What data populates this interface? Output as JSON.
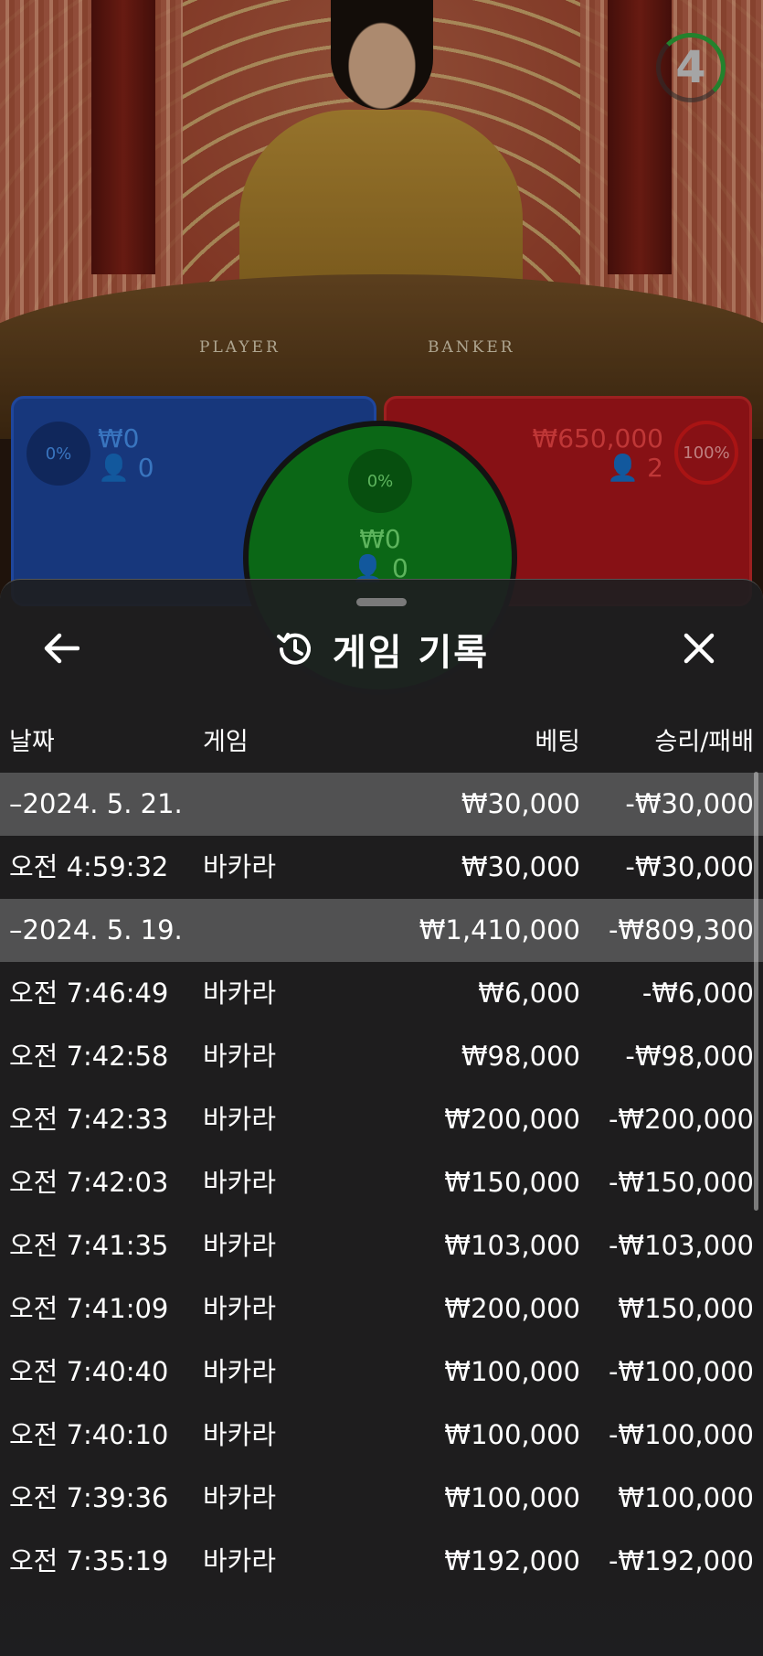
{
  "game": {
    "timer": "4",
    "table_labels": {
      "player": "PLAYER",
      "banker": "BANKER"
    },
    "player": {
      "pct": "0%",
      "amount": "₩0",
      "users": "0"
    },
    "tie": {
      "pct": "0%",
      "amount": "₩0",
      "users": "0"
    },
    "banker": {
      "pct": "100%",
      "amount": "₩650,000",
      "users": "2"
    }
  },
  "history": {
    "title": "게임 기록",
    "columns": {
      "date": "날짜",
      "game": "게임",
      "bet": "베팅",
      "result": "승리/패배"
    },
    "rows": [
      {
        "type": "group",
        "date": "–2024. 5. 21.",
        "game": "",
        "bet": "₩30,000",
        "result": "-₩30,000"
      },
      {
        "type": "item",
        "date": "오전 4:59:32",
        "game": "바카라",
        "bet": "₩30,000",
        "result": "-₩30,000"
      },
      {
        "type": "group",
        "date": "–2024. 5. 19.",
        "game": "",
        "bet": "₩1,410,000",
        "result": "-₩809,300"
      },
      {
        "type": "item",
        "date": "오전 7:46:49",
        "game": "바카라",
        "bet": "₩6,000",
        "result": "-₩6,000"
      },
      {
        "type": "item",
        "date": "오전 7:42:58",
        "game": "바카라",
        "bet": "₩98,000",
        "result": "-₩98,000"
      },
      {
        "type": "item",
        "date": "오전 7:42:33",
        "game": "바카라",
        "bet": "₩200,000",
        "result": "-₩200,000"
      },
      {
        "type": "item",
        "date": "오전 7:42:03",
        "game": "바카라",
        "bet": "₩150,000",
        "result": "-₩150,000"
      },
      {
        "type": "item",
        "date": "오전 7:41:35",
        "game": "바카라",
        "bet": "₩103,000",
        "result": "-₩103,000"
      },
      {
        "type": "item",
        "date": "오전 7:41:09",
        "game": "바카라",
        "bet": "₩200,000",
        "result": "₩150,000"
      },
      {
        "type": "item",
        "date": "오전 7:40:40",
        "game": "바카라",
        "bet": "₩100,000",
        "result": "-₩100,000"
      },
      {
        "type": "item",
        "date": "오전 7:40:10",
        "game": "바카라",
        "bet": "₩100,000",
        "result": "-₩100,000"
      },
      {
        "type": "item",
        "date": "오전 7:39:36",
        "game": "바카라",
        "bet": "₩100,000",
        "result": "₩100,000"
      },
      {
        "type": "item",
        "date": "오전 7:35:19",
        "game": "바카라",
        "bet": "₩192,000",
        "result": "-₩192,000"
      }
    ]
  },
  "colors": {
    "player": "#1f4aa6",
    "banker": "#b4171d",
    "tie": "#0f8a1e",
    "sheet": "#1e1e20",
    "group_row": "#5a5a5c"
  },
  "icons": {
    "back": "arrow-left-icon",
    "history": "history-clock-icon",
    "close": "close-icon",
    "user": "user-icon"
  }
}
